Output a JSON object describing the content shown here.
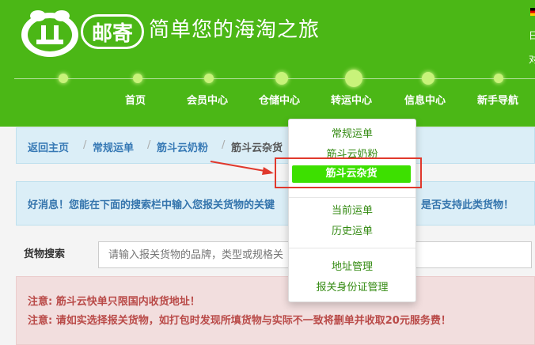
{
  "header": {
    "logo_badge": "邮寄",
    "slogan": "简单您的海淘之旅",
    "corner_top": "日",
    "corner_bottom": "对",
    "nav": [
      "首页",
      "会员中心",
      "仓储中心",
      "转运中心",
      "信息中心",
      "新手导航"
    ]
  },
  "breadcrumb": {
    "items": [
      "返回主页",
      "常规运单",
      "筋斗云奶粉",
      "筋斗云杂货"
    ],
    "separator": "/"
  },
  "info": {
    "left": "好消息！您能在下面的搜索栏中输入您报关货物的关键",
    "right": "是否支持此类货物！"
  },
  "search": {
    "label": "货物搜索",
    "placeholder": "请输入报关货物的品牌，类型或规格关"
  },
  "warnings": [
    "注意: 筋斗云快单只限国内收货地址！",
    "注意: 请如实选择报关货物，如打包时发现所填货物与实际不一致将删单并收取20元服务费！"
  ],
  "dropdown": {
    "items": [
      "常规运单",
      "筋斗云奶粉",
      "筋斗云杂货",
      "当前运单",
      "历史运单",
      "地址管理",
      "报关身份证管理"
    ],
    "active_index": 2
  },
  "colors": {
    "brand_green": "#4bb716",
    "link_blue": "#3779b5",
    "warning_red": "#b94a48",
    "active_item": "#3de000",
    "annotation_red": "#e0382c"
  }
}
